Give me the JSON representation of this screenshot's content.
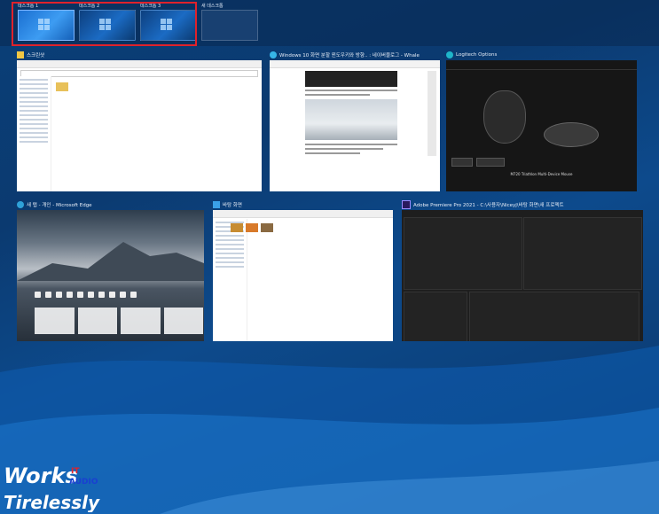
{
  "desktops": [
    {
      "label": "데스크톱 1",
      "active": true
    },
    {
      "label": "데스크톱 2",
      "active": false
    },
    {
      "label": "데스크톱 3",
      "active": false
    },
    {
      "label": "새 데스크톱",
      "active": false
    }
  ],
  "windows": {
    "explorer": {
      "title": "스크린샷"
    },
    "whale": {
      "title": "Windows 10 화면 분할 윈도우키와 방향.. : 네이버블로그 - Whale"
    },
    "logitech": {
      "title": "Logitech Options",
      "product": "M720 Triathlon Multi-Device Mouse"
    },
    "edge": {
      "title": "새 탭 - 개인 - Microsoft Edge"
    },
    "explorer2": {
      "title": "바탕 화면"
    },
    "premiere": {
      "title": "Adobe Premiere Pro 2021 - C:\\사용자\\Niceyj\\바탕 화면\\새 프로젝트"
    }
  },
  "watermark": {
    "line1": "Works",
    "line2": "Tirelessly",
    "it": "IT",
    "audio": "AUDIO"
  },
  "colors": {
    "highlight": "#e0222b",
    "accent": "#1a6fd1"
  }
}
